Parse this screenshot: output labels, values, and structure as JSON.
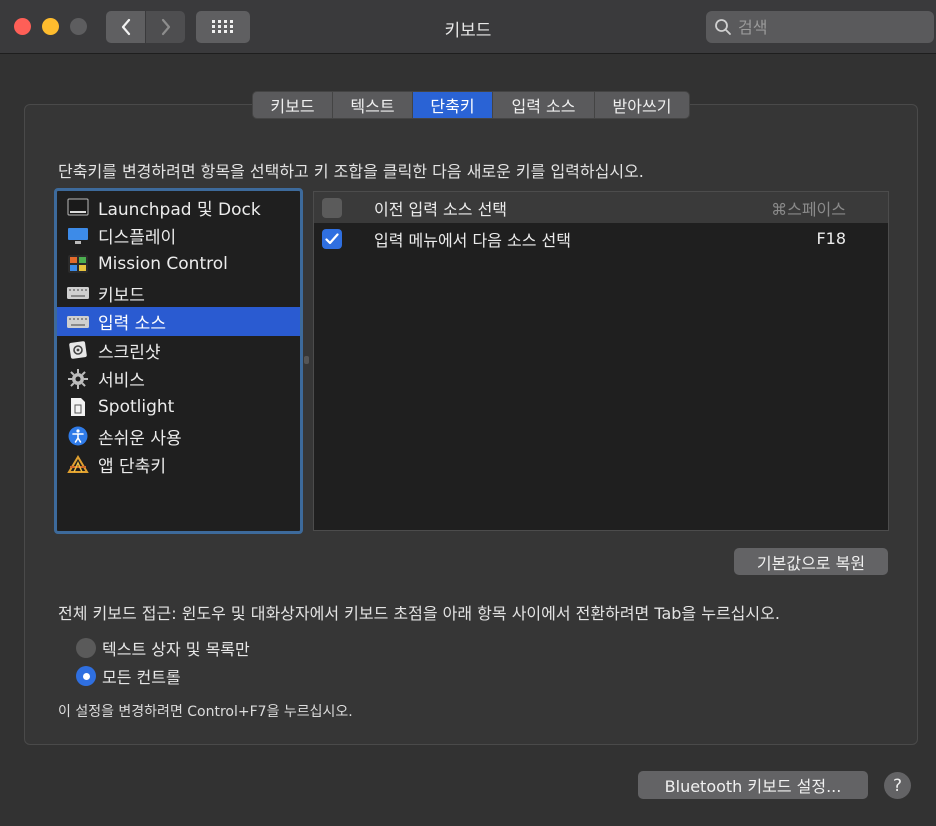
{
  "window": {
    "title": "키보드",
    "search_placeholder": "검색"
  },
  "tabs": [
    {
      "label": "키보드",
      "active": false
    },
    {
      "label": "텍스트",
      "active": false
    },
    {
      "label": "단축키",
      "active": true
    },
    {
      "label": "입력 소스",
      "active": false
    },
    {
      "label": "받아쓰기",
      "active": false
    }
  ],
  "instruction": "단축키를 변경하려면 항목을 선택하고 키 조합을 클릭한 다음 새로운 키를 입력하십시오.",
  "categories": [
    {
      "label": "Launchpad 및 Dock",
      "icon": "launchpad-dock-icon",
      "selected": false
    },
    {
      "label": "디스플레이",
      "icon": "display-icon",
      "selected": false
    },
    {
      "label": "Mission Control",
      "icon": "mission-control-icon",
      "selected": false
    },
    {
      "label": "키보드",
      "icon": "keyboard-icon",
      "selected": false
    },
    {
      "label": "입력 소스",
      "icon": "keyboard-icon",
      "selected": true
    },
    {
      "label": "스크린샷",
      "icon": "screenshot-icon",
      "selected": false
    },
    {
      "label": "서비스",
      "icon": "gear-icon",
      "selected": false
    },
    {
      "label": "Spotlight",
      "icon": "document-icon",
      "selected": false
    },
    {
      "label": "손쉬운 사용",
      "icon": "accessibility-icon",
      "selected": false
    },
    {
      "label": "앱 단축키",
      "icon": "app-shortcuts-icon",
      "selected": false
    }
  ],
  "shortcuts": [
    {
      "label": "이전 입력 소스 선택",
      "key": "⌘스페이스",
      "checked": false
    },
    {
      "label": "입력 메뉴에서 다음 소스 선택",
      "key": "F18",
      "checked": true
    }
  ],
  "restore_button": "기본값으로 복원",
  "full_keyboard_access": {
    "text": "전체 키보드 접근: 윈도우 및 대화상자에서 키보드 초점을 아래 항목 사이에서 전환하려면 Tab을 누르십시오.",
    "options": [
      {
        "label": "텍스트 상자 및 목록만",
        "selected": false
      },
      {
        "label": "모든 컨트롤",
        "selected": true
      }
    ],
    "note": "이 설정을 변경하려면 Control+F7을 누르십시오."
  },
  "bluetooth_button": "Bluetooth 키보드 설정...",
  "help_label": "?",
  "colors": {
    "accent": "#2a5bd1",
    "close": "#fe5f57",
    "minimize": "#febc2e"
  }
}
